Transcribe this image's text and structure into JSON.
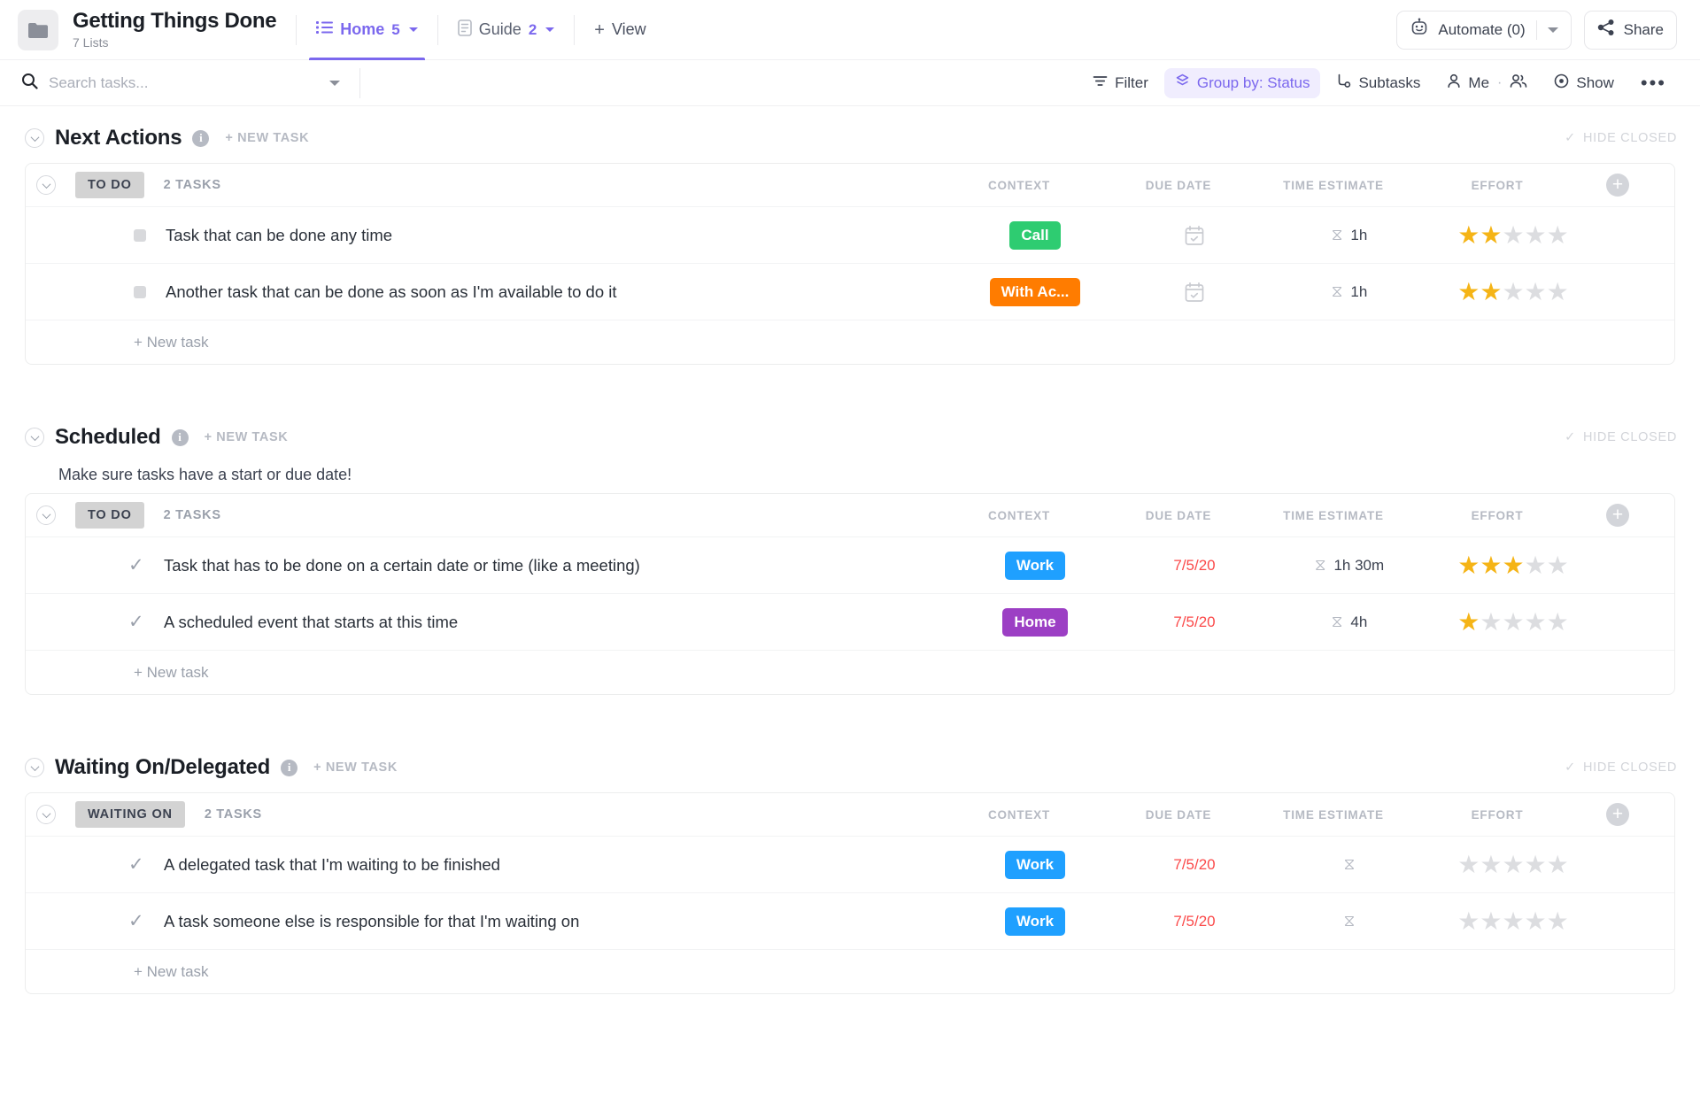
{
  "header": {
    "folder_icon": "folder-icon",
    "title": "Getting Things Done",
    "subtitle": "7 Lists",
    "tabs": [
      {
        "icon": "list-view-icon",
        "label": "Home",
        "count": "5",
        "active": true
      },
      {
        "icon": "doc-view-icon",
        "label": "Guide",
        "count": "2",
        "active": false
      }
    ],
    "add_view_label": "View",
    "automate_label": "Automate (0)",
    "automate_icon": "robot-icon",
    "share_label": "Share",
    "share_icon": "share-icon"
  },
  "toolbar": {
    "search_placeholder": "Search tasks...",
    "search_value": "",
    "search_icon": "search-icon",
    "filter_label": "Filter",
    "group_by_label": "Group by: Status",
    "subtasks_label": "Subtasks",
    "me_label": "Me",
    "show_label": "Show",
    "more_label": "•••"
  },
  "columns": {
    "context": "CONTEXT",
    "due_date": "DUE DATE",
    "time_estimate": "TIME ESTIMATE",
    "effort": "EFFORT"
  },
  "labels": {
    "new_task_caps": "+ NEW TASK",
    "hide_closed": "HIDE CLOSED",
    "new_task": "+ New task",
    "tasks_suffix": "TASKS"
  },
  "colors": {
    "accent": "#7b68ee",
    "tag_call": "#2ecc71",
    "tag_with_ac": "#ff7c00",
    "tag_work": "#1fa0ff",
    "tag_home": "#9c3fc4",
    "due_red": "#fb4a4a",
    "star_on": "#f5b416",
    "star_off": "#dcdde0"
  },
  "sections": [
    {
      "title": "Next Actions",
      "description": "",
      "groups": [
        {
          "status": "TO DO",
          "count_text": "2 TASKS",
          "tasks": [
            {
              "status_icon": "square-status-icon",
              "name": "Task that can be done any time",
              "context": "Call",
              "context_color": "#2ecc71",
              "due_date": "",
              "due_icon": "calendar-icon",
              "time_estimate": "1h",
              "stars_filled": 2,
              "stars_total": 5
            },
            {
              "status_icon": "square-status-icon",
              "name": "Another task that can be done as soon as I'm available to do it",
              "context": "With Ac...",
              "context_color": "#ff7c00",
              "due_date": "",
              "due_icon": "calendar-icon",
              "time_estimate": "1h",
              "stars_filled": 2,
              "stars_total": 5
            }
          ]
        }
      ]
    },
    {
      "title": "Scheduled",
      "description": "Make sure tasks have a start or due date!",
      "groups": [
        {
          "status": "TO DO",
          "count_text": "2 TASKS",
          "tasks": [
            {
              "status_icon": "check-status-icon",
              "name": "Task that has to be done on a certain date or time (like a meeting)",
              "context": "Work",
              "context_color": "#1fa0ff",
              "due_date": "7/5/20",
              "due_icon": "",
              "time_estimate": "1h 30m",
              "stars_filled": 3,
              "stars_total": 5
            },
            {
              "status_icon": "check-status-icon",
              "name": "A scheduled event that starts at this time",
              "context": "Home",
              "context_color": "#9c3fc4",
              "due_date": "7/5/20",
              "due_icon": "",
              "time_estimate": "4h",
              "stars_filled": 1,
              "stars_total": 5
            }
          ]
        }
      ]
    },
    {
      "title": "Waiting On/Delegated",
      "description": "",
      "groups": [
        {
          "status": "WAITING ON",
          "count_text": "2 TASKS",
          "tasks": [
            {
              "status_icon": "check-status-icon",
              "name": "A delegated task that I'm waiting to be finished",
              "context": "Work",
              "context_color": "#1fa0ff",
              "due_date": "7/5/20",
              "due_icon": "",
              "time_estimate": "",
              "stars_filled": 0,
              "stars_total": 5
            },
            {
              "status_icon": "check-status-icon",
              "name": "A task someone else is responsible for that I'm waiting on",
              "context": "Work",
              "context_color": "#1fa0ff",
              "due_date": "7/5/20",
              "due_icon": "",
              "time_estimate": "",
              "stars_filled": 0,
              "stars_total": 5
            }
          ]
        }
      ]
    }
  ]
}
